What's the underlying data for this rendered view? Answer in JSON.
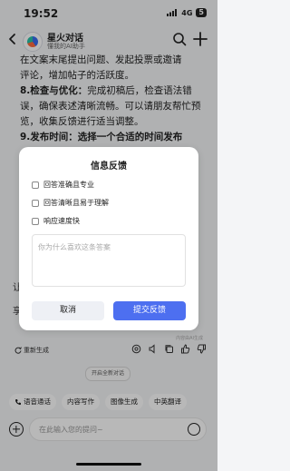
{
  "status_bar": {
    "time": "19:52",
    "network": "4G",
    "battery": "5"
  },
  "header": {
    "title": "星火对话",
    "subtitle": "懂我的AI助手"
  },
  "content": {
    "lines": [
      "在文案末尾提出问题、发起投票或邀请",
      "评论，增加帖子的活跃度。"
    ],
    "item8_title": "8.检查与优化：",
    "item8_text": "完成初稿后，检查语法错误，确保表述清晰流畅。可以请朋友帮忙预览，收集反馈进行适当调整。",
    "item9_partial": "9.发布时间：选择一个合适的时间发布",
    "left_partial_1": "让",
    "left_partial_2": "享"
  },
  "answer_footer": {
    "regenerate": "重新生成",
    "ai_note": "内容由AI生成"
  },
  "new_chat": "开启全新对话",
  "quick_actions": [
    {
      "icon": "phone-icon",
      "label": "语音通话"
    },
    {
      "icon": "pen-icon",
      "label": "内容写作"
    },
    {
      "icon": "image-icon",
      "label": "图像生成"
    },
    {
      "icon": "translate-icon",
      "label": "中英翻译"
    }
  ],
  "input": {
    "placeholder": "在此输入您的提问~"
  },
  "modal": {
    "title": "信息反馈",
    "options": [
      "回答准确且专业",
      "回答清晰且易于理解",
      "响应速度快"
    ],
    "textarea_placeholder": "你为什么喜欢这条答案",
    "cancel": "取消",
    "submit": "提交反馈"
  },
  "colors": {
    "accent": "#4d6ff0",
    "background": "#f4f5f7"
  }
}
